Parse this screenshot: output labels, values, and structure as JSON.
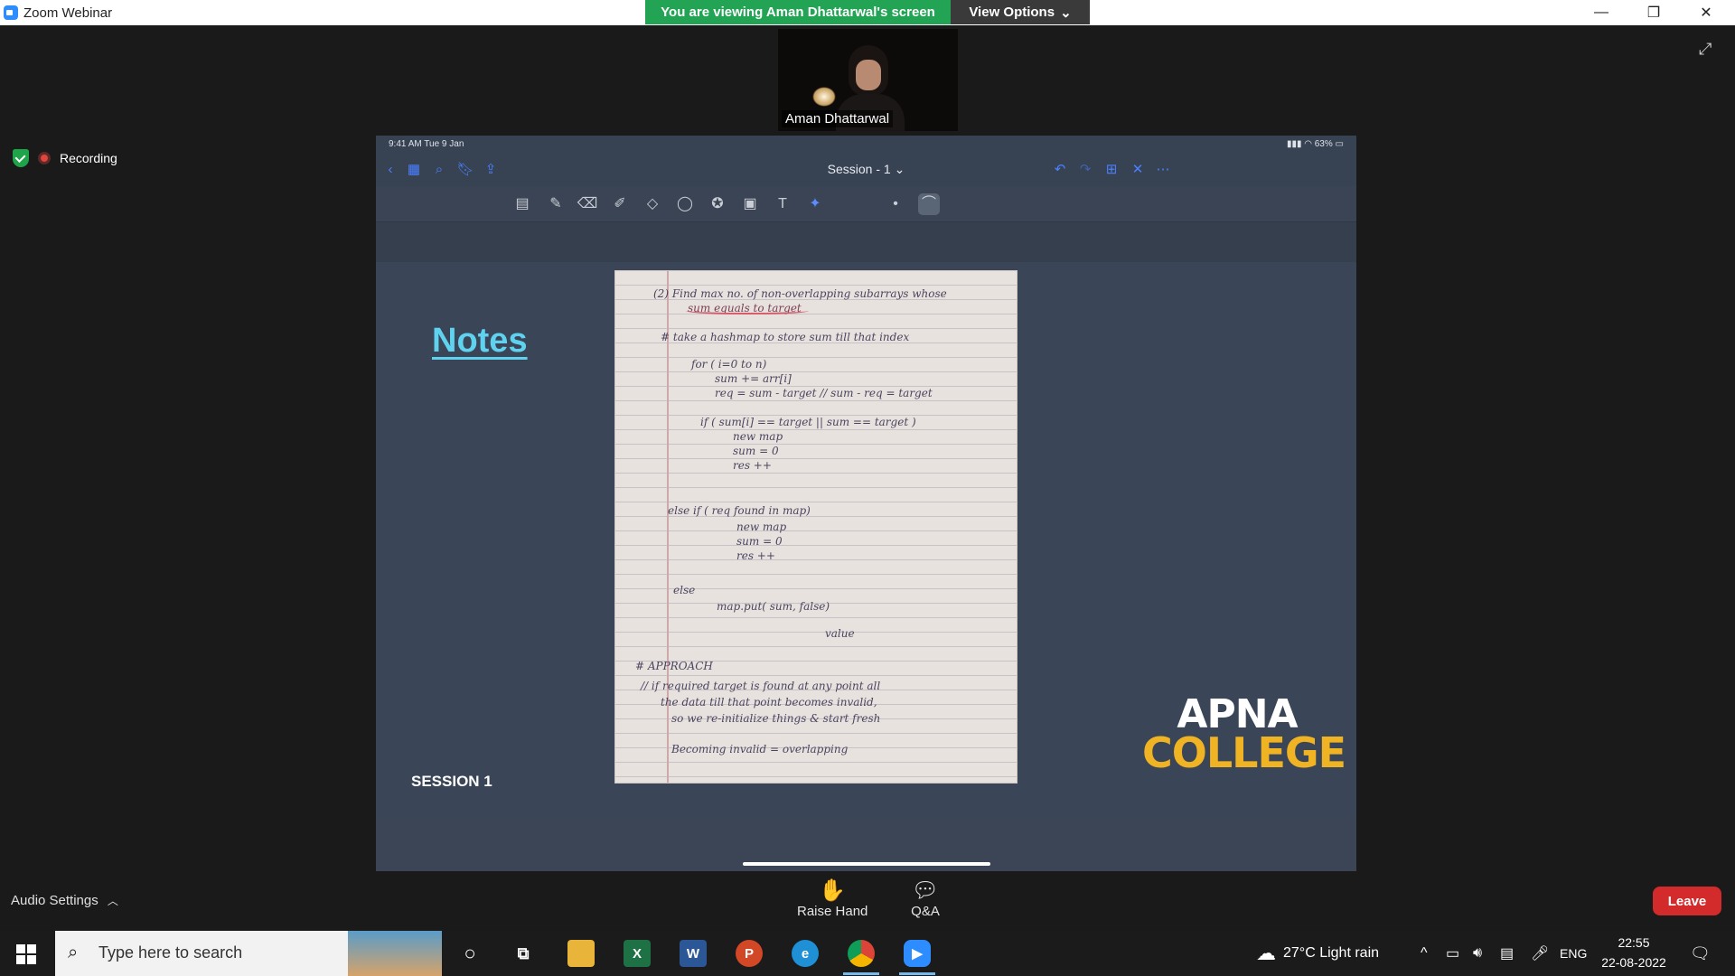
{
  "window": {
    "title": "Zoom Webinar",
    "min_glyph": "—",
    "restore_glyph": "❐",
    "close_glyph": "✕"
  },
  "banner": {
    "viewing_text": "You are viewing Aman Dhattarwal's screen",
    "view_options_label": "View Options"
  },
  "video": {
    "participant_name": "Aman Dhattarwal"
  },
  "status": {
    "recording_label": "Recording"
  },
  "share": {
    "ipad_time": "9:41 AM  Tue 9 Jan",
    "ipad_battery": "63%",
    "document_title": "Session - 1",
    "slide": {
      "notes_heading": "Notes",
      "session_label": "SESSION 1",
      "logo_line1": "APNA",
      "logo_line2": "COLLEGE"
    },
    "handwriting": [
      "(2)   Find max no. of non-overlapping subarrays whose",
      "sum equals to target",
      "#  take a hashmap to store sum till that index",
      "for ( i=0  to n)",
      "sum += arr[i]",
      "req = sum - target   //  sum - req = target",
      "if ( sum[i] == target || sum == target )",
      "new map",
      "sum = 0",
      "res ++",
      "else if ( req found in map)",
      "new map",
      "sum = 0",
      "res ++",
      "else",
      "map.put( sum, false)",
      "value",
      "#  APPROACH",
      "// if required target is found at any point all",
      "the data till that point becomes invalid,",
      "so we re-initialize things & start fresh",
      "Becoming invalid = overlapping"
    ]
  },
  "controls": {
    "audio_settings_label": "Audio Settings",
    "raise_hand_label": "Raise Hand",
    "qa_label": "Q&A",
    "leave_label": "Leave"
  },
  "taskbar": {
    "search_placeholder": "Type here to search",
    "weather": "27°C  Light rain",
    "language": "ENG",
    "time": "22:55",
    "date": "22-08-2022"
  }
}
